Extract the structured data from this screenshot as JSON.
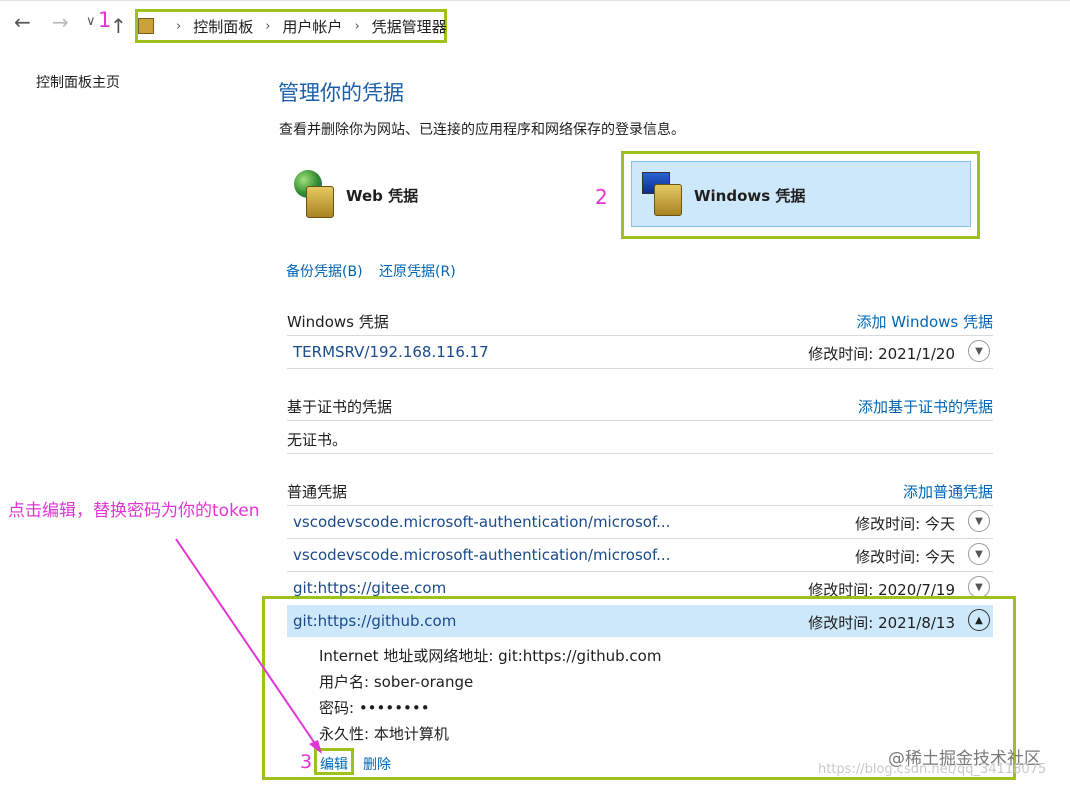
{
  "nav": {
    "annotation_1": "1",
    "breadcrumb": [
      "控制面板",
      "用户帐户",
      "凭据管理器"
    ]
  },
  "sidebar": {
    "home_link": "控制面板主页"
  },
  "main": {
    "title": "管理你的凭据",
    "subtitle": "查看并删除你为网站、已连接的应用程序和网络保存的登录信息。",
    "tabs": [
      {
        "label": "Web 凭据"
      },
      {
        "label": "Windows 凭据"
      }
    ],
    "annotation_2": "2",
    "backup_link": "备份凭据(B)",
    "restore_link": "还原凭据(R)"
  },
  "windows_section": {
    "title": "Windows 凭据",
    "action": "添加 Windows 凭据",
    "items": [
      {
        "name": "TERMSRV/192.168.116.17",
        "time": "修改时间: 2021/1/20"
      }
    ]
  },
  "cert_section": {
    "title": "基于证书的凭据",
    "action": "添加基于证书的凭据",
    "empty": "无证书。"
  },
  "generic_section": {
    "title": "普通凭据",
    "action": "添加普通凭据",
    "items": [
      {
        "name": "vscodevscode.microsoft-authentication/microsof...",
        "time": "修改时间: 今天"
      },
      {
        "name": "vscodevscode.microsoft-authentication/microsof...",
        "time": "修改时间: 今天"
      },
      {
        "name": "git:https://gitee.com",
        "time": "修改时间: 2020/7/19"
      },
      {
        "name": "git:https://github.com",
        "time": "修改时间: 2021/8/13"
      }
    ],
    "expanded": {
      "address": "Internet 地址或网络地址: git:https://github.com",
      "username": "用户名: sober-orange",
      "password": "密码: ••••••••",
      "persistence": "永久性: 本地计算机",
      "edit": "编辑",
      "delete": "删除",
      "annotation_3": "3"
    }
  },
  "annotation_note": "点击编辑，替换密码为你的token",
  "watermark": {
    "brand": "@稀土掘金技术社区",
    "url": "https://blog.csdn.net/qq_34118075"
  },
  "colors": {
    "accent_blue": "#0066b4",
    "highlight_green": "#9dc31a",
    "annotation_magenta": "#e135d5",
    "selected_row": "#cde8fb"
  }
}
